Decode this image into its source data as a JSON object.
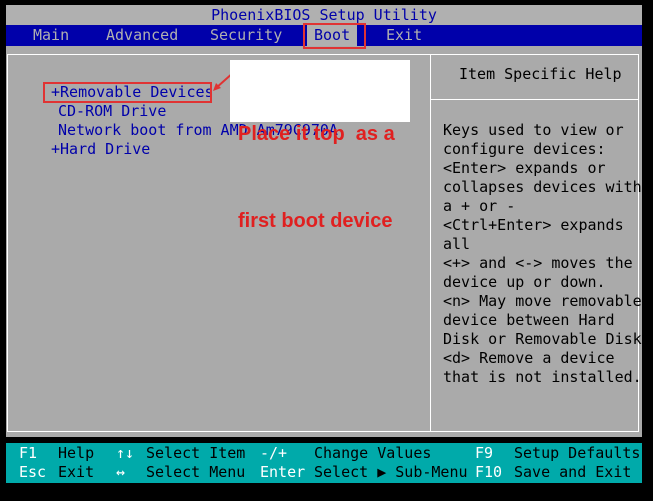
{
  "title": "PhoenixBIOS Setup Utility",
  "menu": {
    "main": "Main",
    "advanced": "Advanced",
    "security": "Security",
    "boot": "Boot",
    "exit": "Exit"
  },
  "boot_list": [
    "+Removable Devices",
    "CD-ROM Drive",
    "Network boot from AMD Am79C970A",
    "+Hard Drive"
  ],
  "help": {
    "title": "Item Specific Help",
    "lines": [
      "Keys used to view or",
      "configure devices:",
      "<Enter> expands or",
      "collapses devices with",
      "a + or -",
      "<Ctrl+Enter> expands",
      "all",
      "<+> and <-> moves the",
      "device up or down.",
      "<n> May move removable",
      "device between Hard",
      "Disk or Removable Disk",
      "<d> Remove a device",
      "that is not installed."
    ]
  },
  "footer": {
    "row1": [
      {
        "key": "F1",
        "desc": "Help"
      },
      {
        "key": "↑↓",
        "desc": "Select Item"
      },
      {
        "key": "-/+",
        "desc": "Change Values"
      },
      {
        "key": "F9",
        "desc": "Setup Defaults"
      }
    ],
    "row2": [
      {
        "key": "Esc",
        "desc": "Exit"
      },
      {
        "key": "↔",
        "desc": "Select Menu"
      },
      {
        "key": "Enter",
        "desc": "Select ▶ Sub-Menu"
      },
      {
        "key": "F10",
        "desc": "Save and Exit"
      }
    ]
  },
  "annotation": {
    "line1": "Place it top  as a",
    "line2": "first boot device"
  },
  "colors": {
    "bios_blue": "#0000aa",
    "panel_gray": "#aaaaaa",
    "footer_cyan": "#00aaaa",
    "annotation_red": "#e02020"
  }
}
